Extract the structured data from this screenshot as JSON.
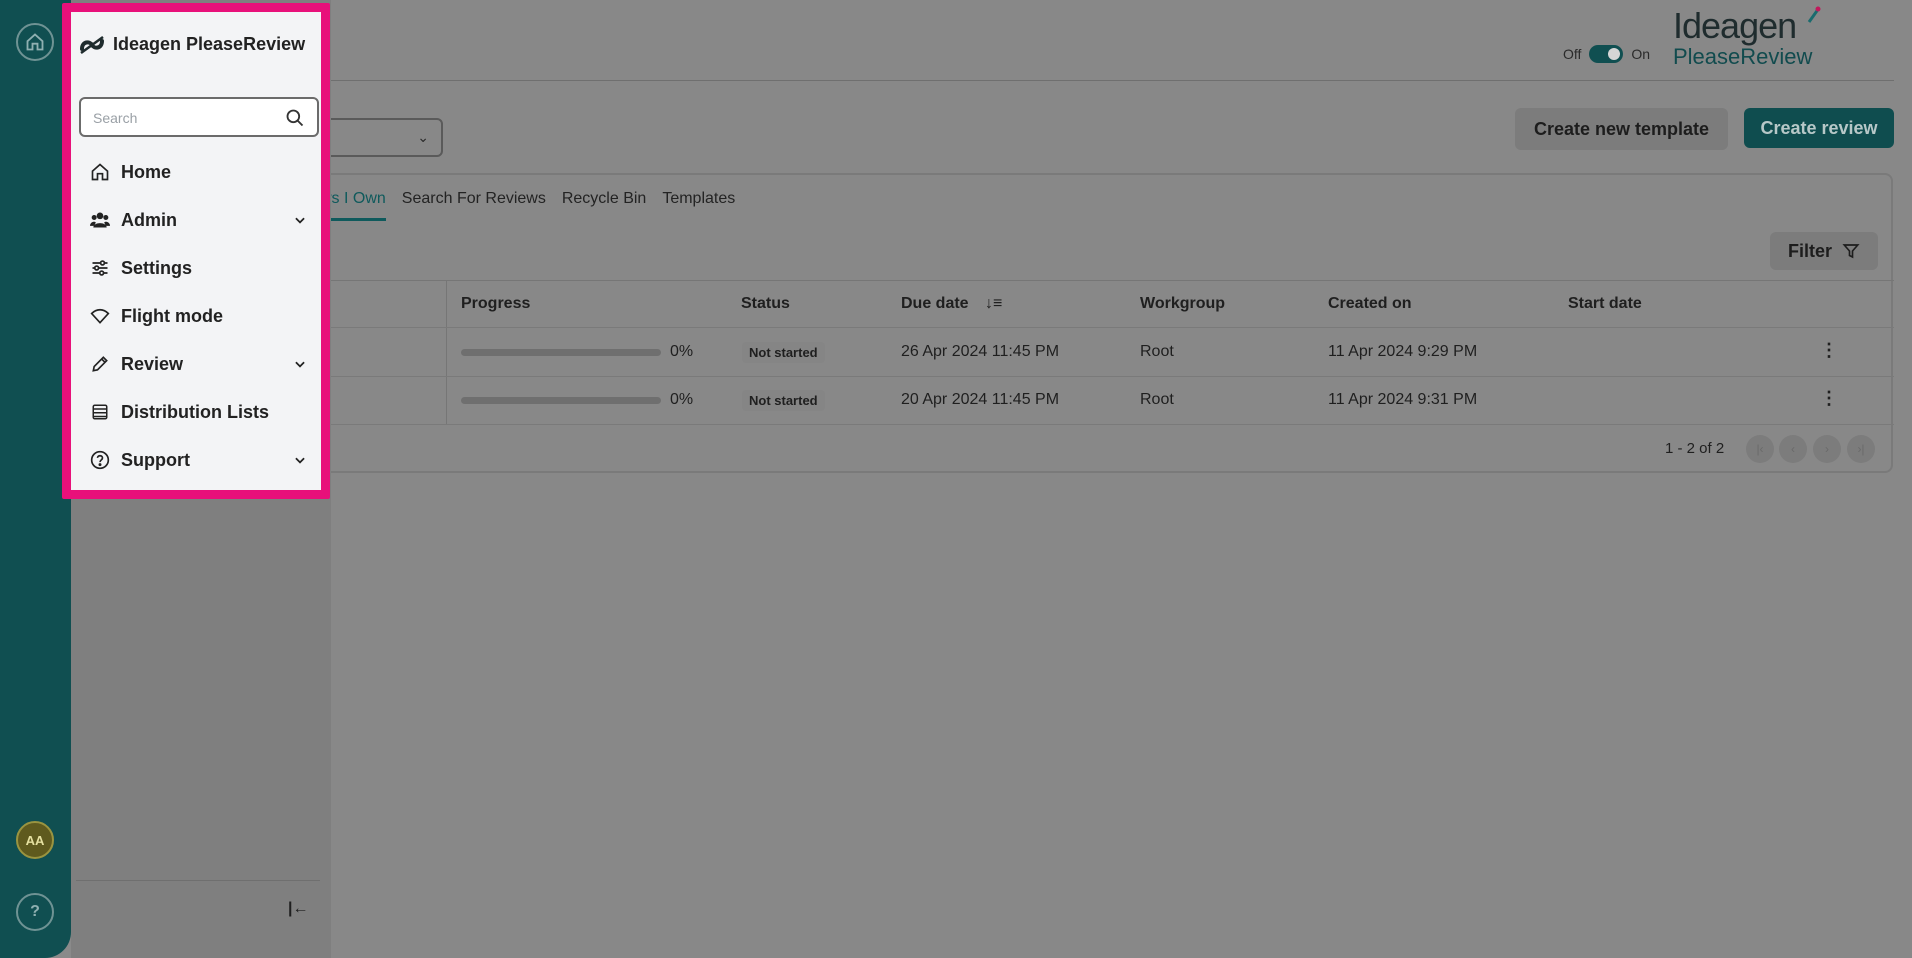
{
  "rail": {
    "avatar_initials": "AA",
    "help_label": "?"
  },
  "header": {
    "toggle_off": "Off",
    "toggle_on": "On",
    "brand_top": "Ideagen",
    "brand_bottom": "PleaseReview"
  },
  "actions": {
    "create_template": "Create new template",
    "create_review": "Create review"
  },
  "tabs": [
    {
      "label": "ws I Own",
      "active": true
    },
    {
      "label": "Search For Reviews",
      "active": false
    },
    {
      "label": "Recycle Bin",
      "active": false
    },
    {
      "label": "Templates",
      "active": false
    }
  ],
  "filter_label": "Filter",
  "table": {
    "headers": [
      "Progress",
      "Status",
      "Due date",
      "Workgroup",
      "Created on",
      "Start date"
    ],
    "rows": [
      {
        "progress": "0%",
        "status": "Not started",
        "due": "26 Apr 2024 11:45 PM",
        "workgroup": "Root",
        "created": "11 Apr 2024 9:29 PM",
        "start": ""
      },
      {
        "progress": "0%",
        "status": "Not started",
        "due": "20 Apr 2024 11:45 PM",
        "workgroup": "Root",
        "created": "11 Apr 2024 9:31 PM",
        "start": ""
      }
    ],
    "pager": "1 - 2 of 2"
  },
  "menu": {
    "brand": "Ideagen PleaseReview",
    "search_placeholder": "Search",
    "items": [
      {
        "label": "Home",
        "icon": "home-icon",
        "expandable": false
      },
      {
        "label": "Admin",
        "icon": "users-icon",
        "expandable": true
      },
      {
        "label": "Settings",
        "icon": "sliders-icon",
        "expandable": false
      },
      {
        "label": "Flight mode",
        "icon": "wifi-icon",
        "expandable": false
      },
      {
        "label": "Review",
        "icon": "pencil-icon",
        "expandable": true
      },
      {
        "label": "Distribution Lists",
        "icon": "list-icon",
        "expandable": false
      },
      {
        "label": "Support",
        "icon": "help-circle-icon",
        "expandable": true
      }
    ]
  },
  "colors": {
    "accent": "#104f51",
    "highlight": "#e8107a"
  }
}
